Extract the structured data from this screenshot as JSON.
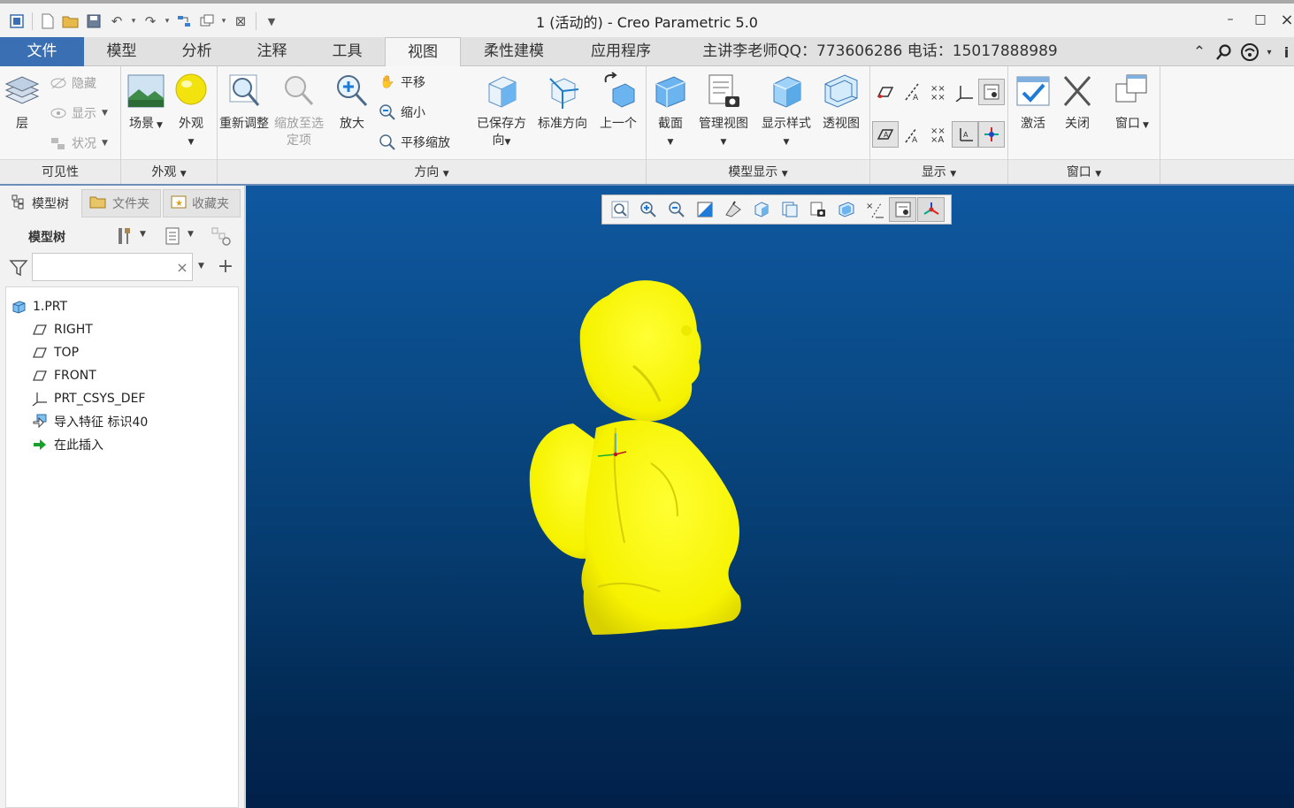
{
  "window": {
    "title": "1 (活动的) - Creo Parametric 5.0",
    "quick_access": [
      "app-icon",
      "new-icon",
      "open-icon",
      "save-icon",
      "undo-icon",
      "redo-icon",
      "regenerate-icon",
      "windows-icon",
      "close-window-icon",
      "customize-icon"
    ],
    "controls": {
      "minimize": "–",
      "maximize": "□",
      "close": "×"
    }
  },
  "ribbon_tabs": [
    {
      "label": "文件"
    },
    {
      "label": "模型"
    },
    {
      "label": "分析"
    },
    {
      "label": "注释"
    },
    {
      "label": "工具"
    },
    {
      "label": "视图"
    },
    {
      "label": "柔性建模"
    },
    {
      "label": "应用程序"
    },
    {
      "label": "主讲李老师QQ：773606286 电话：15017888989"
    }
  ],
  "active_tab": "视图",
  "groups": {
    "visibility": {
      "label": "可见性",
      "layer": "层",
      "hide": "隐藏",
      "show": "显示",
      "status": "状况"
    },
    "appearance": {
      "label": "外观",
      "scene": "场景",
      "appearance": "外观"
    },
    "orientation": {
      "label": "方向",
      "refit": "重新调整",
      "zoom_to_selected": "缩放至选定项",
      "zoom_in": "放大",
      "pan": "平移",
      "zoom_out": "缩小",
      "pan_zoom": "平移缩放",
      "saved_orientations": "已保存方向",
      "standard_orientation": "标准方向",
      "previous": "上一个"
    },
    "model_display": {
      "label": "模型显示",
      "section": "截面",
      "manage_views": "管理视图",
      "display_style": "显示样式",
      "perspective": "透视图"
    },
    "show": {
      "label": "显示"
    },
    "window": {
      "label": "窗口",
      "activate": "激活",
      "close": "关闭",
      "windows": "窗口"
    }
  },
  "left_panel": {
    "tabs": [
      "模型树",
      "文件夹",
      "收藏夹"
    ],
    "header": "模型树",
    "search_placeholder": "",
    "tree": [
      {
        "label": "1.PRT",
        "icon": "part-icon",
        "level": 0
      },
      {
        "label": "RIGHT",
        "icon": "datum-plane-icon",
        "level": 1
      },
      {
        "label": "TOP",
        "icon": "datum-plane-icon",
        "level": 1
      },
      {
        "label": "FRONT",
        "icon": "datum-plane-icon",
        "level": 1
      },
      {
        "label": "PRT_CSYS_DEF",
        "icon": "csys-icon",
        "level": 1
      },
      {
        "label": "导入特征 标识40",
        "icon": "import-feature-icon",
        "level": 1
      },
      {
        "label": "在此插入",
        "icon": "insert-here-arrow-icon",
        "level": 1
      }
    ]
  },
  "graphics_toolbar": [
    "refit-icon",
    "zoom-in-icon",
    "zoom-out-icon",
    "repaint-icon",
    "display-style-icon",
    "saved-orientations-icon",
    "view-manager-icon",
    "perspective-icon",
    "section-icon",
    "datum-display-icon",
    "spin-center-icon",
    "annotation-display-icon"
  ],
  "colors": {
    "file_tab": "#3a6fb3",
    "model": "#ffff00",
    "viewport_top": "#0f58a0",
    "viewport_bottom": "#01204a"
  }
}
